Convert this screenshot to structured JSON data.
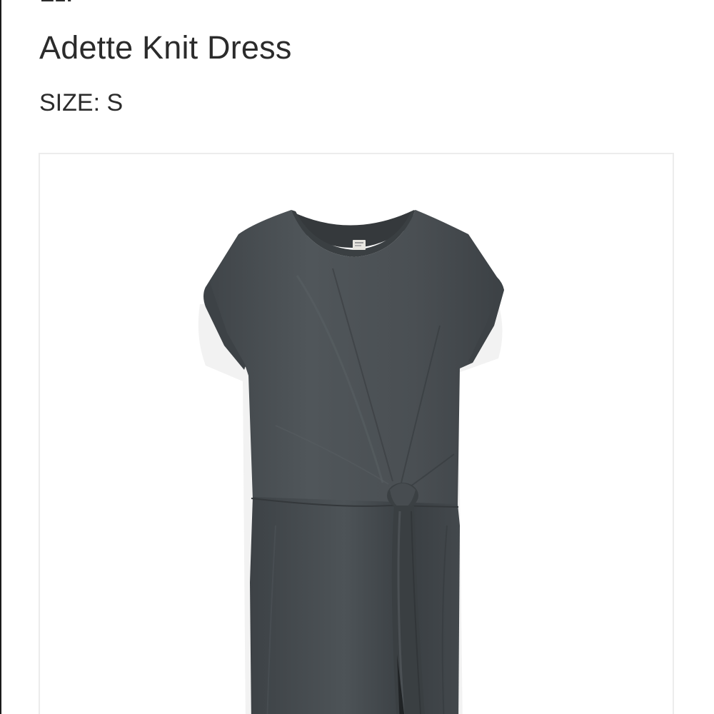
{
  "brand": {
    "partial_text": "Ezr"
  },
  "product": {
    "title": "Adette Knit Dress",
    "size_label": "SIZE:",
    "size_value": "S",
    "image": {
      "subject": "dress-image",
      "color": "#4a4f53"
    }
  }
}
